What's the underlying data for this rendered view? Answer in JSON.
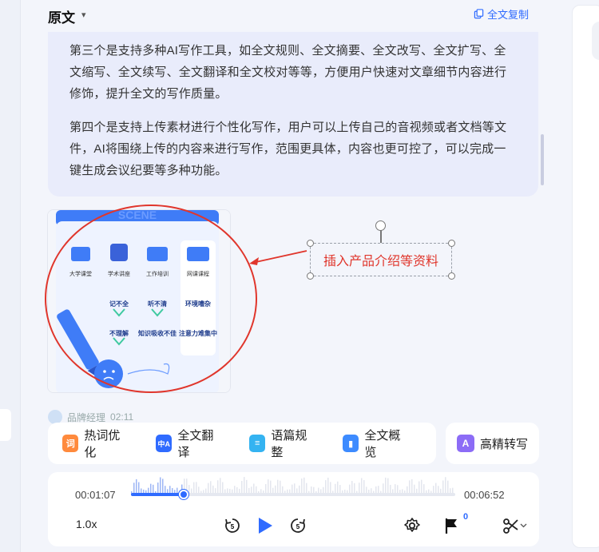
{
  "header": {
    "title": "原文",
    "copy_label": "全文复制"
  },
  "article": {
    "paragraphs": [
      "第三个是支持多种AI写作工具，如全文规则、全文摘要、全文改写、全文扩写、全文缩写、全文续写、全文翻译和全文校对等等，方便用户快速对文章细节内容进行修饰，提升全文的写作质量。",
      "第四个是支持上传素材进行个性化写作，用户可以上传自己的音视频或者文档等文件，AI将围绕上传的内容来进行写作，范围更具体，内容也更可控了，可以完成一键生成会议纪要等多种功能。"
    ]
  },
  "image": {
    "scene_label": "SCENE",
    "row1": [
      "大学课堂",
      "学术讲座",
      "工作培训",
      "网课课程"
    ],
    "row2": [
      "记不全",
      "听不清",
      "环境嘈杂"
    ],
    "row3": [
      "不理解",
      "知识吸收不佳",
      "注意力难集中"
    ]
  },
  "annotation": {
    "text": "插入产品介绍等资料"
  },
  "author": {
    "name": "品牌经理",
    "time": "02:11"
  },
  "tools": [
    {
      "label": "热词优化",
      "icon": "hotword-icon",
      "glyph": "词",
      "color": "#ff8a3d"
    },
    {
      "label": "全文翻译",
      "icon": "translate-icon",
      "glyph": "中A",
      "color": "#2f6bff"
    },
    {
      "label": "语篇规整",
      "icon": "organize-icon",
      "glyph": "≡",
      "color": "#34b3f1"
    },
    {
      "label": "全文概览",
      "icon": "overview-icon",
      "glyph": "▮",
      "color": "#3d8bff"
    }
  ],
  "hq_tool": {
    "label": "高精转写",
    "icon": "hq-transcribe-icon",
    "glyph": "A",
    "color": "#8c6cf6"
  },
  "player": {
    "current_time": "00:01:07",
    "total_time": "00:06:52",
    "progress": 0.162,
    "speed": "1.0x",
    "rewind_label": "5",
    "forward_label": "5",
    "flag_count": "0"
  }
}
